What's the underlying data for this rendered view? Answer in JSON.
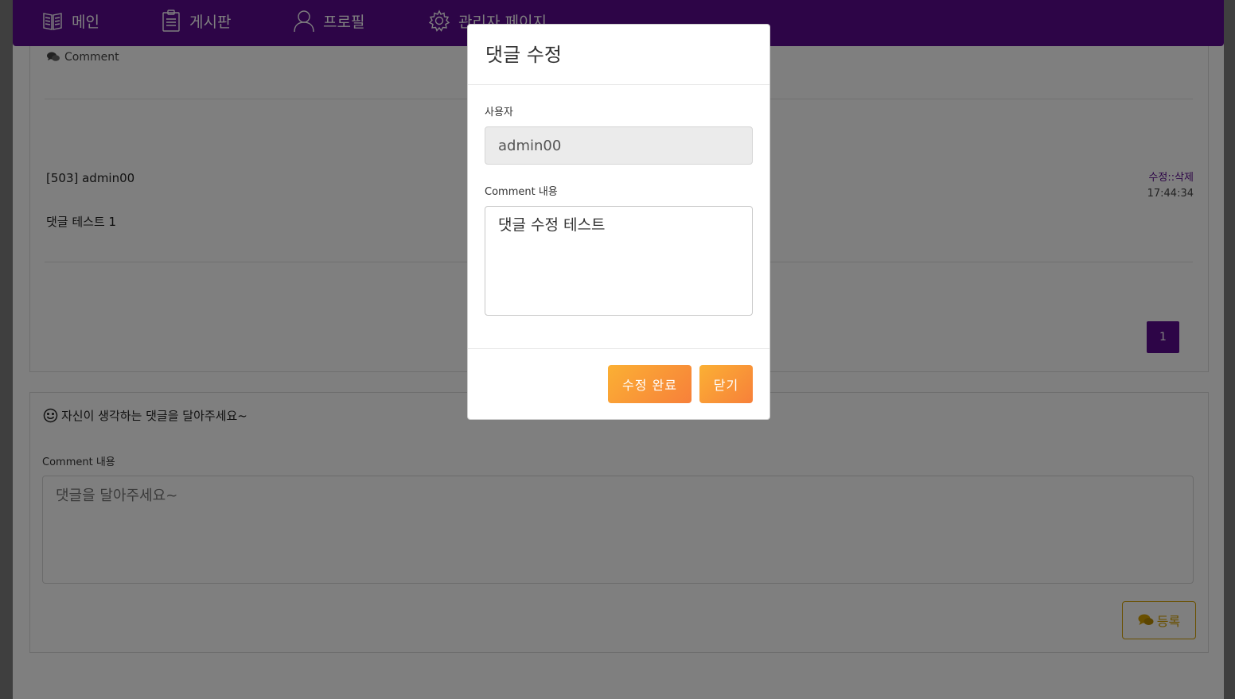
{
  "nav": {
    "items": [
      {
        "label": "메인",
        "icon": "book-icon"
      },
      {
        "label": "게시판",
        "icon": "clipboard-icon"
      },
      {
        "label": "프로필",
        "icon": "user-icon"
      },
      {
        "label": "관리자 페이지",
        "icon": "gear-icon"
      }
    ]
  },
  "comments": {
    "header": "Comment",
    "item": {
      "author": "[503] admin00",
      "body": "댓글 테스트 1",
      "edit_label": "수정",
      "separator": "::",
      "delete_label": "삭제",
      "time": "17:44:34"
    },
    "pagination": {
      "current": "1"
    }
  },
  "comment_form": {
    "title": "자신이 생각하는 댓글을 달아주세요~",
    "label": "Comment 내용",
    "placeholder": "댓글을 달아주세요~",
    "submit_label": "등록"
  },
  "modal": {
    "title": "댓글 수정",
    "user_label": "사용자",
    "user_value": "admin00",
    "content_label": "Comment 내용",
    "content_value": "댓글 수정 테스트",
    "save_label": "수정 완료",
    "close_label": "닫기"
  },
  "colors": {
    "nav_bg": "#5a0b8e",
    "accent_orange": "#f7803a",
    "submit_border": "#d4a000"
  }
}
